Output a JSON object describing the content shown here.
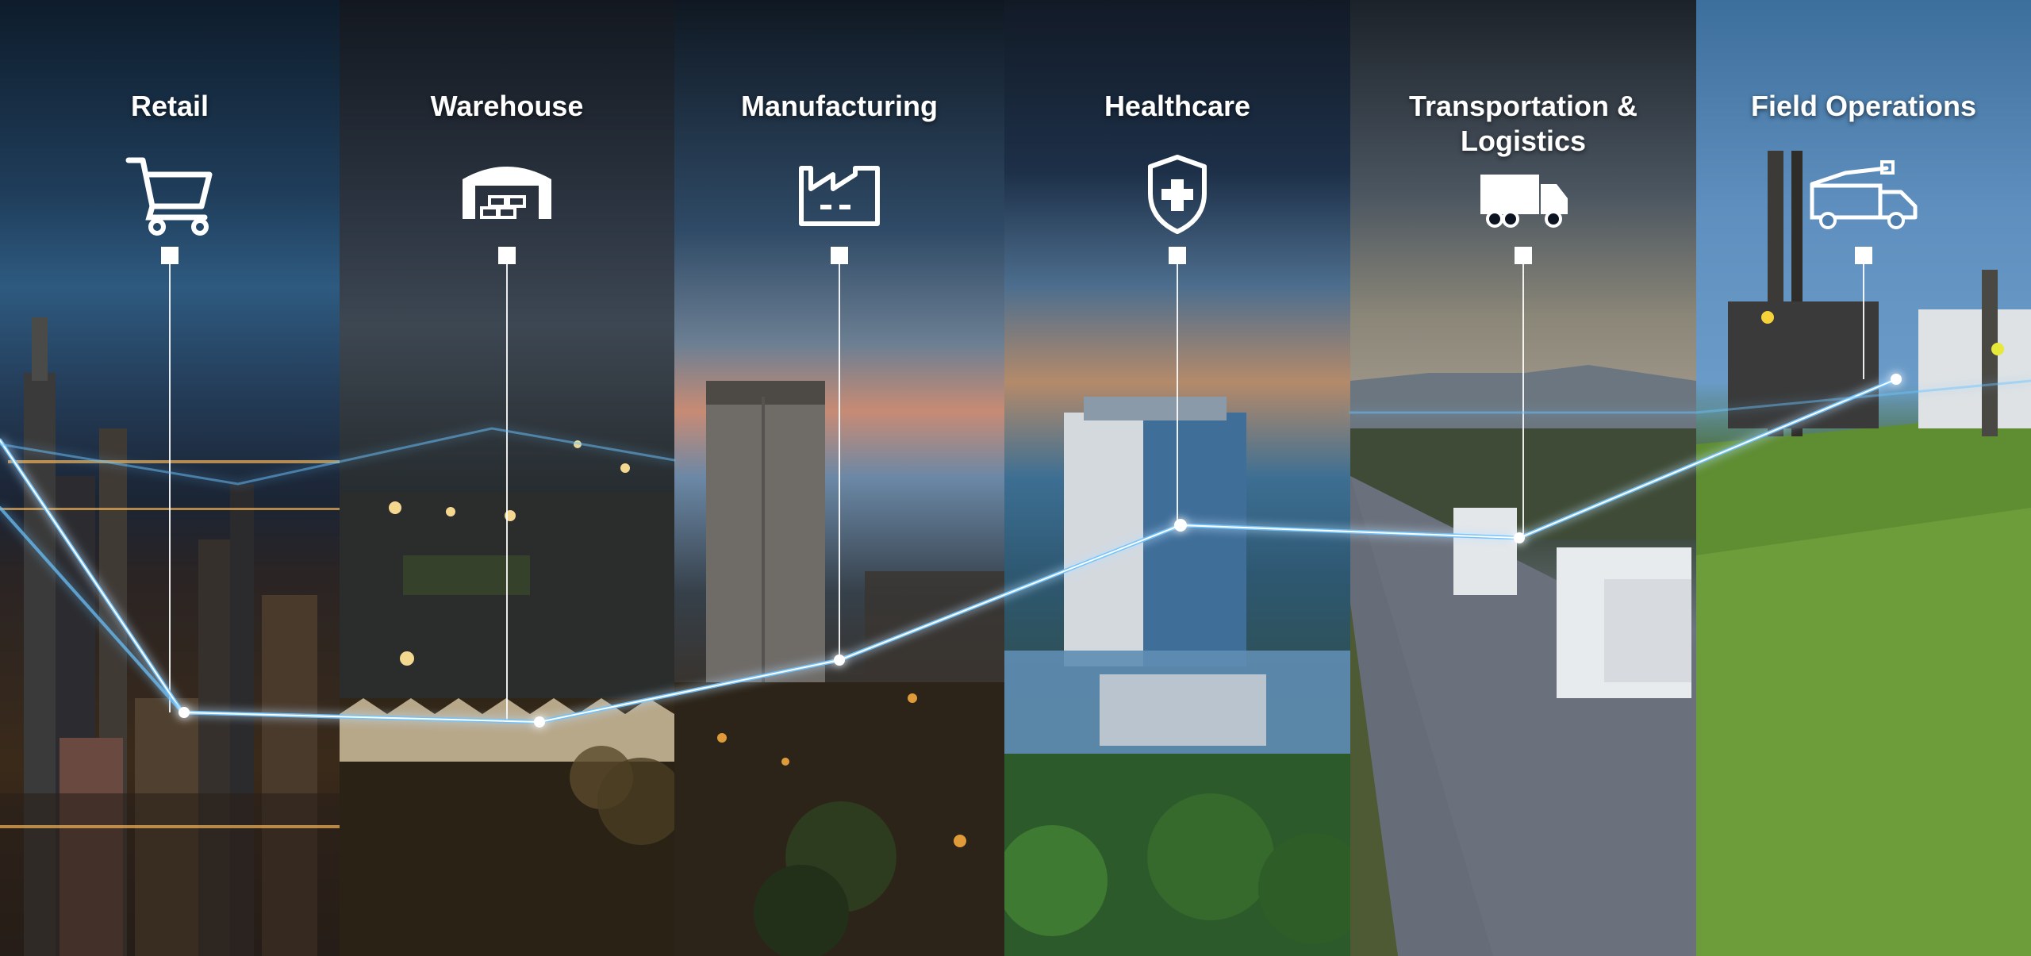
{
  "panels": [
    {
      "title": "Retail",
      "icon": "shopping-cart-icon"
    },
    {
      "title": "Warehouse",
      "icon": "warehouse-icon"
    },
    {
      "title": "Manufacturing",
      "icon": "factory-icon"
    },
    {
      "title": "Healthcare",
      "icon": "medical-shield-icon"
    },
    {
      "title": "Transportation &\nLogistics",
      "icon": "truck-icon"
    },
    {
      "title": "Field Operations",
      "icon": "utility-truck-icon"
    }
  ],
  "colors": {
    "title_text": "#ffffff",
    "icon": "#ffffff",
    "connection_line": "#6cc4ff"
  }
}
